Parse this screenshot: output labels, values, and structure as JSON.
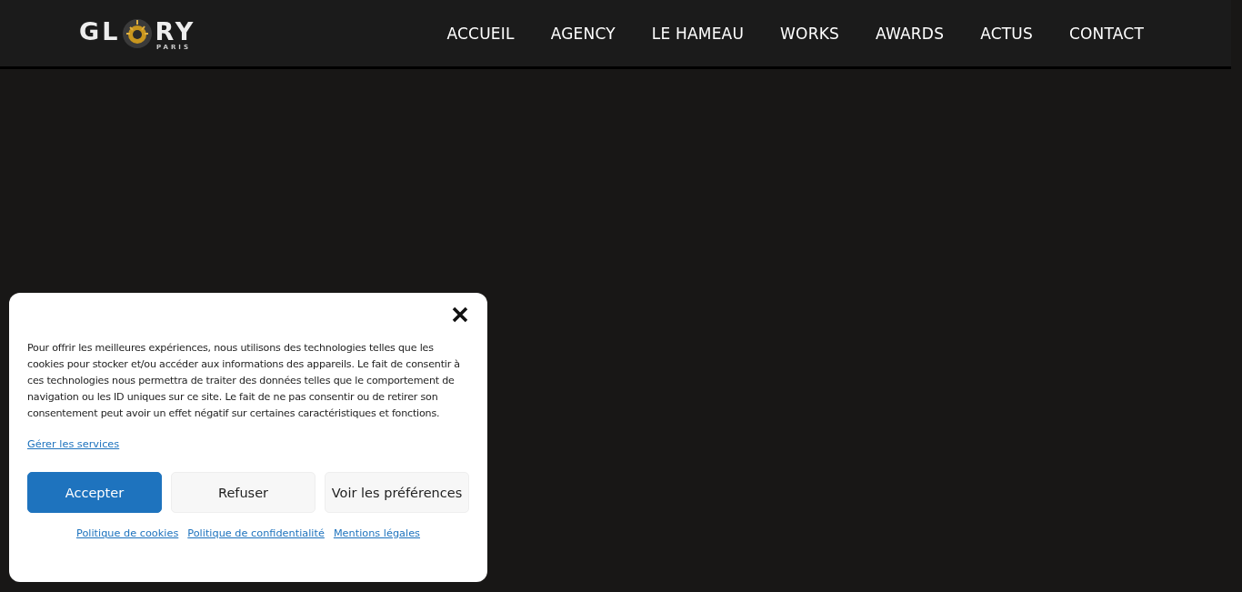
{
  "logo": {
    "left": "GL",
    "right": "RY",
    "tagline": "PARIS"
  },
  "nav": [
    {
      "label": "ACCUEIL"
    },
    {
      "label": "AGENCY"
    },
    {
      "label": "LE HAMEAU"
    },
    {
      "label": "WORKS"
    },
    {
      "label": "AWARDS"
    },
    {
      "label": "ACTUS"
    },
    {
      "label": "CONTACT"
    }
  ],
  "cookie_banner": {
    "message": "Pour offrir les meilleures expériences, nous utilisons des technologies telles que les cookies pour stocker et/ou accéder aux informations des appareils. Le fait de consentir à ces technologies nous permettra de traiter des données telles que le comportement de navigation ou les ID uniques sur ce site. Le fait de ne pas consentir ou de retirer son consentement peut avoir un effet négatif sur certaines caractéristiques et fonctions.",
    "manage_link": "Gérer les services",
    "buttons": [
      {
        "label": "Accepter",
        "kind": "primary"
      },
      {
        "label": "Refuser",
        "kind": "secondary"
      },
      {
        "label": "Voir les préférences",
        "kind": "secondary"
      }
    ],
    "links": [
      "Politique de cookies",
      "Politique de confidentialité",
      "Mentions légales"
    ]
  }
}
